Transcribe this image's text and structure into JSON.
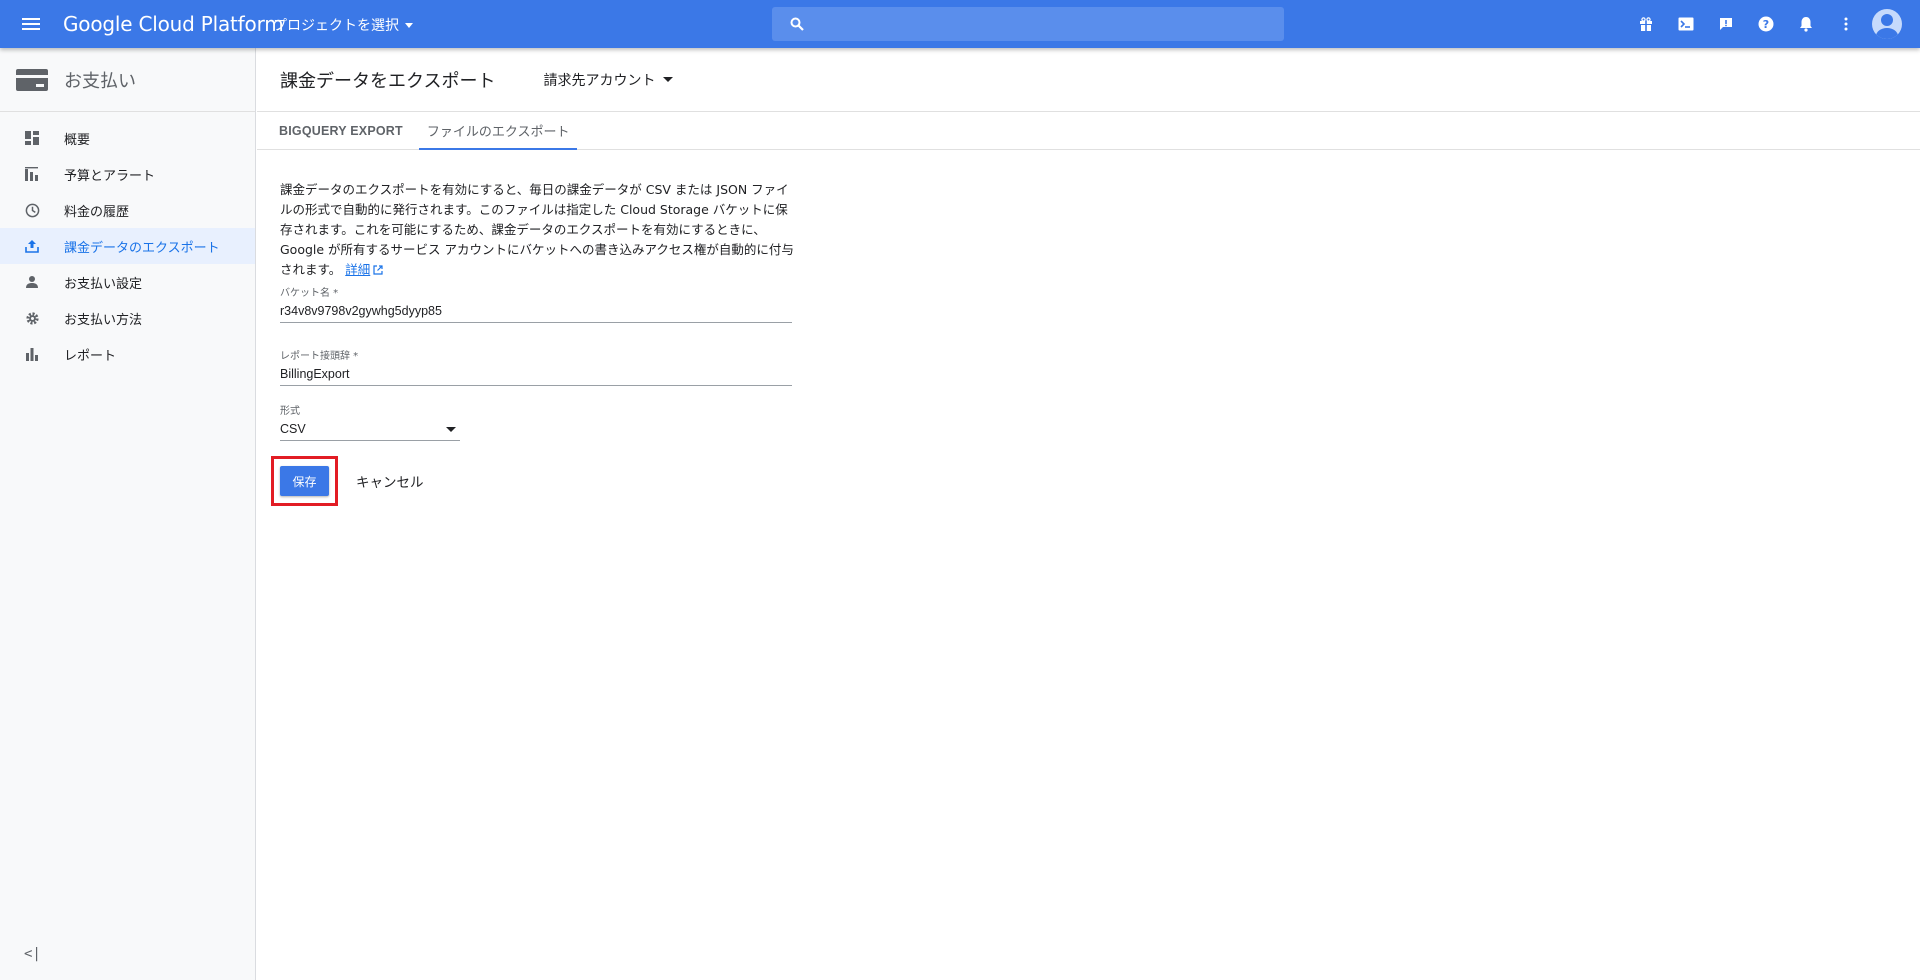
{
  "topbar": {
    "brand": "Google Cloud Platform",
    "project_selector": "プロジェクトを選択",
    "search_placeholder": "",
    "icons": [
      "gift-icon",
      "terminal-icon",
      "feedback-icon",
      "help-icon",
      "bell-icon",
      "more-vert-icon",
      "avatar"
    ]
  },
  "sidebar": {
    "title": "お支払い",
    "items": [
      {
        "label": "概要",
        "icon": "dashboard-icon",
        "active": false
      },
      {
        "label": "予算とアラート",
        "icon": "budget-icon",
        "active": false
      },
      {
        "label": "料金の履歴",
        "icon": "history-icon",
        "active": false
      },
      {
        "label": "課金データのエクスポート",
        "icon": "upload-icon",
        "active": true
      },
      {
        "label": "お支払い設定",
        "icon": "person-icon",
        "active": false
      },
      {
        "label": "お支払い方法",
        "icon": "settings-icon",
        "active": false
      },
      {
        "label": "レポート",
        "icon": "bar-chart-icon",
        "active": false
      }
    ],
    "collapse_label": "<|"
  },
  "main": {
    "title": "課金データをエクスポート",
    "account_selector": "請求先アカウント",
    "tabs": [
      {
        "label": "BIGQUERY EXPORT",
        "active": false
      },
      {
        "label": "ファイルのエクスポート",
        "active": true
      }
    ],
    "description": "課金データのエクスポートを有効にすると、毎日の課金データが CSV または JSON ファイルの形式で自動的に発行されます。このファイルは指定した Cloud Storage バケットに保存されます。これを可能にするため、課金データのエクスポートを有効にするときに、Google が所有するサービス アカウントにバケットへの書き込みアクセス権が自動的に付与されます。",
    "details_link": "詳細",
    "bucket": {
      "label": "バケット名 *",
      "value": "r34v8v9798v2gywhg5dyyp85"
    },
    "prefix": {
      "label": "レポート接頭辞 *",
      "value": "BillingExport"
    },
    "format": {
      "label": "形式",
      "value": "CSV"
    },
    "save_label": "保存",
    "cancel_label": "キャンセル"
  },
  "colors": {
    "topbar": "#3b78e7",
    "accent": "#1a73e8",
    "highlight": "#e21c24"
  }
}
